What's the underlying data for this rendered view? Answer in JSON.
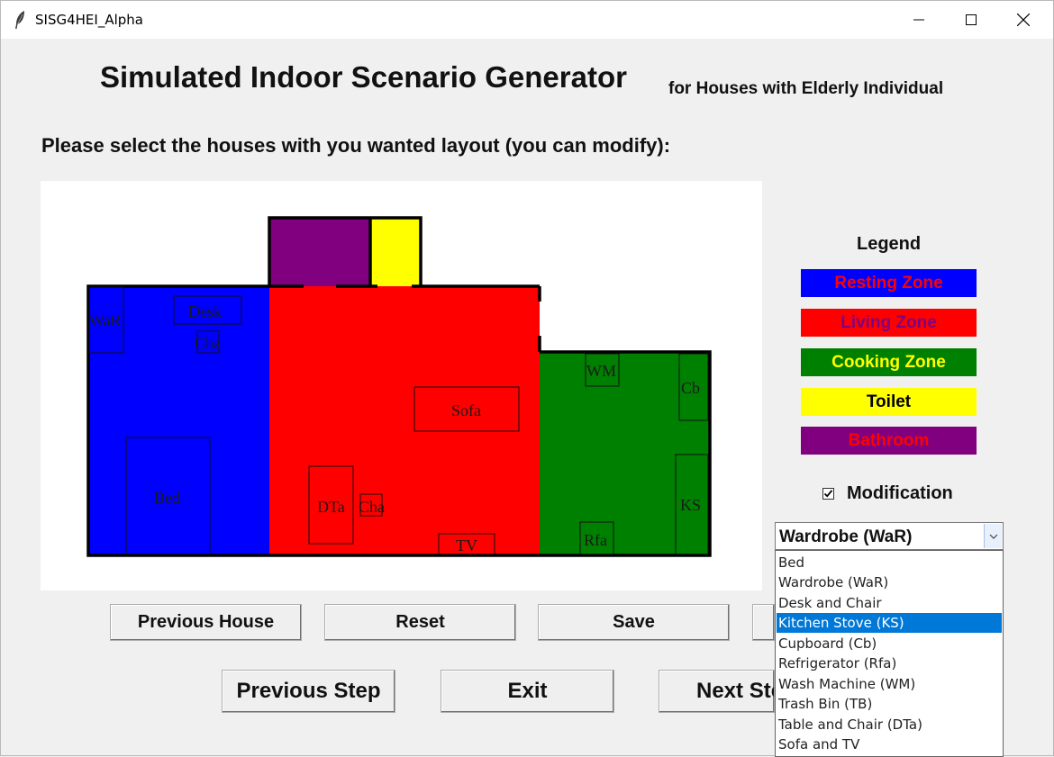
{
  "window": {
    "title": "SISG4HEI_Alpha"
  },
  "header": {
    "title": "Simulated Indoor Scenario Generator",
    "subtitle": "for Houses with Elderly Individual",
    "prompt": "Please select the houses with you wanted layout (you can modify):"
  },
  "floorplan": {
    "zones": [
      {
        "name": "resting",
        "color": "#0000ff"
      },
      {
        "name": "living",
        "color": "#ff0000"
      },
      {
        "name": "cooking",
        "color": "#008000"
      },
      {
        "name": "toilet",
        "color": "#ffff00"
      },
      {
        "name": "bathroom",
        "color": "#800080"
      }
    ],
    "furniture": [
      "WaR",
      "Desk",
      "Cha",
      "Bed",
      "Sofa",
      "DTa",
      "Cha",
      "TV",
      "WM",
      "Cb",
      "KS",
      "Rfa"
    ]
  },
  "legend": {
    "title": "Legend",
    "items": [
      {
        "label": "Resting Zone",
        "bg": "#0000ff",
        "fg": "#ff0000"
      },
      {
        "label": "Living Zone",
        "bg": "#ff0000",
        "fg": "#800080"
      },
      {
        "label": "Cooking Zone",
        "bg": "#008000",
        "fg": "#ffff00"
      },
      {
        "label": "Toilet",
        "bg": "#ffff00",
        "fg": "#000000"
      },
      {
        "label": "Bathroom",
        "bg": "#800080",
        "fg": "#ff0000"
      }
    ]
  },
  "modification": {
    "label": "Modification",
    "checked": true
  },
  "furniture_select": {
    "value": "Wardrobe (WaR)",
    "options": [
      "Bed",
      "Wardrobe (WaR)",
      "Desk and Chair",
      "Kitchen Stove (KS)",
      "Cupboard (Cb)",
      "Refrigerator (Rfa)",
      "Wash Machine (WM)",
      "Trash Bin (TB)",
      "Table and Chair (DTa)",
      "Sofa and TV"
    ],
    "highlighted": "Kitchen Stove (KS)"
  },
  "buttons": {
    "previous_house": "Previous House",
    "reset": "Reset",
    "save": "Save",
    "previous_step": "Previous Step",
    "exit": "Exit",
    "next_step": "Next Step"
  }
}
